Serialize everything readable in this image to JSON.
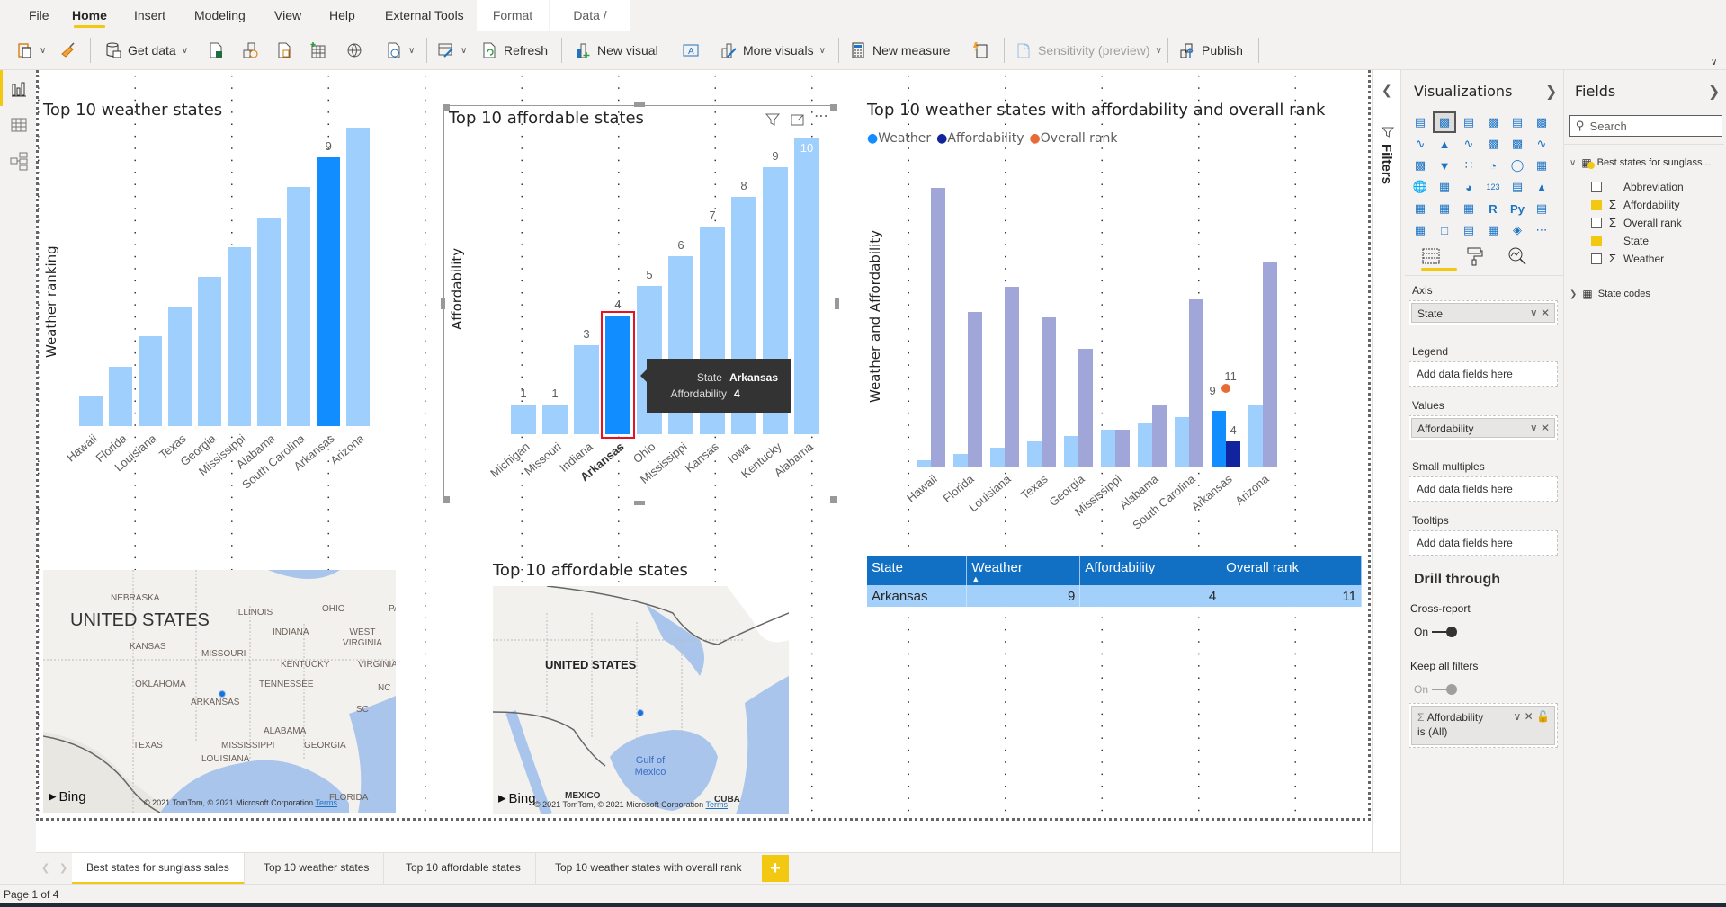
{
  "menu": {
    "items": [
      "File",
      "Home",
      "Insert",
      "Modeling",
      "View",
      "Help",
      "External Tools"
    ],
    "context_items": [
      "Format",
      "Data / Drill"
    ],
    "active": "Home"
  },
  "ribbon": {
    "get_data": "Get data",
    "refresh": "Refresh",
    "new_visual": "New visual",
    "more_visuals": "More visuals",
    "new_measure": "New measure",
    "sensitivity": "Sensitivity (preview)",
    "publish": "Publish"
  },
  "visuals": {
    "weather_chart": {
      "title": "Top 10 weather states",
      "ylabel": "Weather ranking"
    },
    "afford_chart": {
      "title": "Top 10 affordable states",
      "ylabel": "Affordability",
      "tooltip": {
        "k1": "State",
        "v1": "Arkansas",
        "k2": "Affordability",
        "v2": "4"
      }
    },
    "combo_chart": {
      "title": "Top 10 weather states with affordability and overall rank",
      "ylabel": "Weather and Affordability",
      "legend": [
        "Weather",
        "Affordability",
        "Overall rank"
      ]
    },
    "table": {
      "headers": [
        "State",
        "Weather",
        "Affordability",
        "Overall rank"
      ],
      "rows": [
        [
          "Arkansas",
          "9",
          "4",
          "11"
        ]
      ]
    },
    "map1": {
      "labels": [
        "UNITED STATES",
        "NEBRASKA",
        "ILLINOIS",
        "OHIO",
        "INDIANA",
        "WEST VIRGINIA",
        "KANSAS",
        "MISSOURI",
        "KENTUCKY",
        "VIRGINIA",
        "OKLAHOMA",
        "TENNESSEE",
        "NC",
        "ARKANSAS",
        "SC",
        "ALABAMA",
        "TEXAS",
        "MISSISSIPPI",
        "GEORGIA",
        "LOUISIANA",
        "FLORIDA",
        "PA"
      ],
      "bing": "Bing",
      "copyright": "© 2021 TomTom, © 2021 Microsoft Corporation",
      "terms": "Terms"
    },
    "map2": {
      "title": "Top 10 affordable states",
      "labels": [
        "UNITED STATES",
        "Gulf of Mexico",
        "MEXICO",
        "CUBA"
      ],
      "bing": "Bing",
      "copyright": "© 2021 TomTom, © 2021 Microsoft Corporation",
      "terms": "Terms"
    }
  },
  "chart_data": [
    {
      "type": "bar",
      "title": "Top 10 weather states",
      "xlabel": "",
      "ylabel": "Weather ranking",
      "categories": [
        "Hawaii",
        "Florida",
        "Louisiana",
        "Texas",
        "Georgia",
        "Mississippi",
        "Alabama",
        "South Carolina",
        "Arkansas",
        "Arizona"
      ],
      "values": [
        1,
        2,
        3,
        4,
        5,
        6,
        7,
        8,
        9,
        10
      ],
      "highlighted": "Arkansas",
      "data_labels": {
        "Arkansas": 9
      },
      "ylim": [
        0,
        10
      ],
      "grid": true
    },
    {
      "type": "bar",
      "title": "Top 10 affordable states",
      "xlabel": "",
      "ylabel": "Affordability",
      "categories": [
        "Michigan",
        "Missouri",
        "Indiana",
        "Arkansas",
        "Ohio",
        "Mississippi",
        "Kansas",
        "Iowa",
        "Kentucky",
        "Alabama"
      ],
      "values": [
        1,
        1,
        3,
        4,
        5,
        6,
        7,
        8,
        9,
        10
      ],
      "highlighted": "Arkansas",
      "ylim": [
        0,
        10
      ],
      "grid": true
    },
    {
      "type": "bar",
      "title": "Top 10 weather states with affordability and overall rank",
      "xlabel": "",
      "ylabel": "Weather and Affordability",
      "categories": [
        "Hawaii",
        "Florida",
        "Louisiana",
        "Texas",
        "Georgia",
        "Mississippi",
        "Alabama",
        "South Carolina",
        "Arkansas",
        "Arizona"
      ],
      "series": [
        {
          "name": "Weather",
          "color": "#118dff",
          "values": [
            1,
            2,
            3,
            4,
            5,
            6,
            7,
            8,
            9,
            10
          ]
        },
        {
          "name": "Affordability",
          "color": "#12239e",
          "values": [
            45,
            25,
            29,
            24,
            19,
            6,
            10,
            27,
            4,
            33
          ]
        },
        {
          "name": "Overall rank",
          "color": "#e66c37",
          "type": "point",
          "values": [
            null,
            null,
            null,
            null,
            null,
            null,
            null,
            null,
            11,
            null
          ]
        }
      ],
      "highlighted": "Arkansas",
      "data_labels": {
        "Arkansas": {
          "Weather": 9,
          "Affordability": 4,
          "Overall rank": 11
        }
      },
      "legend": "top-left",
      "ylim": [
        0,
        50
      ],
      "grid": true
    }
  ],
  "panes": {
    "filters_label": "Filters",
    "visualizations": {
      "title": "Visualizations",
      "wells": [
        {
          "label": "Axis",
          "value": "State"
        },
        {
          "label": "Legend",
          "placeholder": "Add data fields here"
        },
        {
          "label": "Values",
          "value": "Affordability"
        },
        {
          "label": "Small multiples",
          "placeholder": "Add data fields here"
        },
        {
          "label": "Tooltips",
          "placeholder": "Add data fields here"
        }
      ],
      "drill_title": "Drill through",
      "cross_report": "Cross-report",
      "cross_report_state": "On",
      "keep_filters": "Keep all filters",
      "keep_filters_state": "On",
      "drill_field": "Affordability",
      "drill_field_state": "is (All)"
    },
    "fields": {
      "title": "Fields",
      "search_placeholder": "Search",
      "tables": [
        {
          "name": "Best states for sunglass...",
          "expanded": true,
          "fields": [
            {
              "name": "Abbreviation",
              "checked": false,
              "sigma": false
            },
            {
              "name": "Affordability",
              "checked": true,
              "sigma": true
            },
            {
              "name": "Overall rank",
              "checked": false,
              "sigma": true
            },
            {
              "name": "State",
              "checked": true,
              "sigma": false
            },
            {
              "name": "Weather",
              "checked": false,
              "sigma": true
            }
          ]
        },
        {
          "name": "State codes",
          "expanded": false
        }
      ]
    }
  },
  "pages": {
    "tabs": [
      "Best states for sunglass sales",
      "Top 10 weather states",
      "Top 10 affordable states",
      "Top 10 weather states with overall rank"
    ],
    "active": 0,
    "add": "+",
    "status": "Page 1 of 4"
  },
  "colors": {
    "accent": "#f2c811",
    "bar_light": "#9fd0fd",
    "bar_selected": "#118dff",
    "afford_light": "#a0a6d8",
    "afford_selected": "#12239e",
    "overall": "#e66c37",
    "table_header": "#1170c4"
  }
}
